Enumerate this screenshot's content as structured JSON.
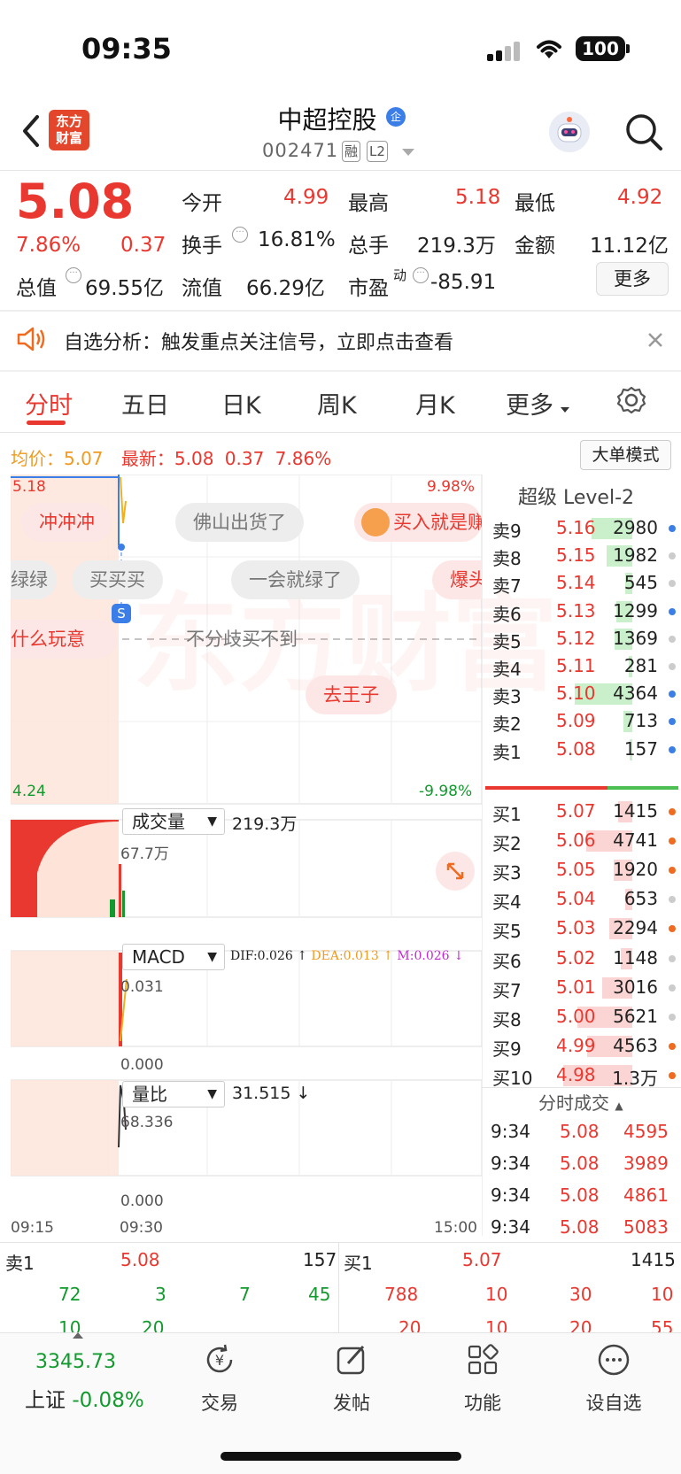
{
  "status": {
    "time": "09:35",
    "battery": "100"
  },
  "header": {
    "logo_line1": "东方",
    "logo_line2": "财富",
    "title": "中超控股",
    "title_badge": "企",
    "code": "002471",
    "tag_rong": "融",
    "tag_l2": "L2"
  },
  "quote": {
    "price": "5.08",
    "change_pct": "7.86%",
    "change": "0.37",
    "open_label": "今开",
    "open": "4.99",
    "high_label": "最高",
    "high": "5.18",
    "low_label": "最低",
    "low": "4.92",
    "turnover_label": "换手",
    "turnover": "16.81%",
    "volume_label": "总手",
    "volume": "219.3万",
    "amount_label": "金额",
    "amount": "11.12亿",
    "mcap_label": "总值",
    "mcap": "69.55亿",
    "float_label": "流值",
    "float": "66.29亿",
    "pe_label": "市盈",
    "pe_sup": "动",
    "pe": "-85.91",
    "more": "更多"
  },
  "notice": {
    "text": "自选分析：触发重点关注信号，立即点击查看"
  },
  "tabs": [
    "分时",
    "五日",
    "日K",
    "周K",
    "月K",
    "更多"
  ],
  "chart_info": {
    "avg_label": "均价：",
    "avg": "5.07",
    "last_label": "最新：",
    "last": "5.08",
    "change": "0.37",
    "pct": "7.86%",
    "mode_button": "大单模式"
  },
  "chart_data": {
    "type": "line",
    "title": "",
    "y_max": "5.18",
    "y_min": "4.24",
    "pct_max": "9.98%",
    "pct_min": "-9.98%",
    "x_ticks": [
      "09:15",
      "09:30",
      "15:00"
    ],
    "price": [
      5.08,
      5.18,
      5.13,
      5.08
    ],
    "volume_panel": {
      "label": "成交量",
      "total": "219.3万",
      "max": "67.7万"
    },
    "macd_panel": {
      "label": "MACD",
      "dif": "DIF:0.026",
      "dea": "DEA:0.013",
      "m": "M:0.026",
      "max": "0.031",
      "min": "0.000"
    },
    "ratio_panel": {
      "label": "量比",
      "value": "31.515",
      "max": "68.336",
      "min": "0.000"
    }
  },
  "danmaku": [
    {
      "text": "冲冲冲",
      "style": "r"
    },
    {
      "text": "佛山出货了",
      "style": "g"
    },
    {
      "text": "买入就是赚",
      "style": "r"
    },
    {
      "text": "绿绿",
      "style": "g"
    },
    {
      "text": "买买买",
      "style": "g"
    },
    {
      "text": "一会就绿了",
      "style": "g"
    },
    {
      "text": "爆头",
      "style": "r"
    },
    {
      "text": "什么玩意",
      "style": "r"
    },
    {
      "text": "不分歧买不到",
      "style": "g"
    },
    {
      "text": "去王子",
      "style": "r"
    }
  ],
  "watermark": "东方财富",
  "orderbook": {
    "title": "超级 Level-2",
    "sells": [
      {
        "label": "卖9",
        "price": "5.16",
        "vol": "2980",
        "fill": 0.35,
        "dot": "#3b7ee8"
      },
      {
        "label": "卖8",
        "price": "5.15",
        "vol": "1982",
        "fill": 0.22,
        "dot": "#ccc"
      },
      {
        "label": "卖7",
        "price": "5.14",
        "vol": "545",
        "fill": 0.06,
        "dot": "#ccc"
      },
      {
        "label": "卖6",
        "price": "5.13",
        "vol": "1299",
        "fill": 0.14,
        "dot": "#3b7ee8"
      },
      {
        "label": "卖5",
        "price": "5.12",
        "vol": "1369",
        "fill": 0.15,
        "dot": "#ccc"
      },
      {
        "label": "卖4",
        "price": "5.11",
        "vol": "281",
        "fill": 0.03,
        "dot": "#ccc"
      },
      {
        "label": "卖3",
        "price": "5.10",
        "vol": "4364",
        "fill": 0.5,
        "dot": "#3b7ee8"
      },
      {
        "label": "卖2",
        "price": "5.09",
        "vol": "713",
        "fill": 0.08,
        "dot": "#3b7ee8"
      },
      {
        "label": "卖1",
        "price": "5.08",
        "vol": "157",
        "fill": 0.02,
        "dot": "#3b7ee8"
      }
    ],
    "buys": [
      {
        "label": "买1",
        "price": "5.07",
        "vol": "1415",
        "fill": 0.12,
        "dot": "#f06a1f"
      },
      {
        "label": "买2",
        "price": "5.06",
        "vol": "4741",
        "fill": 0.4,
        "dot": "#f06a1f"
      },
      {
        "label": "买3",
        "price": "5.05",
        "vol": "1920",
        "fill": 0.16,
        "dot": "#f06a1f"
      },
      {
        "label": "买4",
        "price": "5.04",
        "vol": "653",
        "fill": 0.06,
        "dot": "#ccc"
      },
      {
        "label": "买5",
        "price": "5.03",
        "vol": "2294",
        "fill": 0.2,
        "dot": "#f06a1f"
      },
      {
        "label": "买6",
        "price": "5.02",
        "vol": "1148",
        "fill": 0.1,
        "dot": "#ccc"
      },
      {
        "label": "买7",
        "price": "5.01",
        "vol": "3016",
        "fill": 0.26,
        "dot": "#ccc"
      },
      {
        "label": "买8",
        "price": "5.00",
        "vol": "5621",
        "fill": 0.48,
        "dot": "#ccc"
      },
      {
        "label": "买9",
        "price": "4.99",
        "vol": "4563",
        "fill": 0.39,
        "dot": "#f06a1f"
      },
      {
        "label": "买10",
        "price": "4.98",
        "vol": "1.3万",
        "fill": 0.6,
        "dot": "#f06a1f"
      }
    ],
    "trades_title": "分时成交",
    "trades": [
      {
        "time": "9:34",
        "price": "5.08",
        "vol": "4595"
      },
      {
        "time": "9:34",
        "price": "5.08",
        "vol": "3989"
      },
      {
        "time": "9:34",
        "price": "5.08",
        "vol": "4861"
      },
      {
        "time": "9:34",
        "price": "5.08",
        "vol": "5083"
      }
    ]
  },
  "queue": {
    "sell_label": "卖1",
    "sell_price": "5.08",
    "sell_vol": "157",
    "buy_label": "买1",
    "buy_price": "5.07",
    "buy_vol": "1415",
    "sell_nums": [
      "72",
      "3",
      "7",
      "45"
    ],
    "sell_nums2": [
      "10",
      "20"
    ],
    "buy_nums": [
      "788",
      "10",
      "30",
      "10"
    ],
    "buy_nums2": [
      "20",
      "10",
      "20",
      "55"
    ]
  },
  "bottom": {
    "index_value": "3345.73",
    "index_label": "上证",
    "index_change": "-0.08%",
    "nav": [
      "交易",
      "发帖",
      "功能",
      "设自选"
    ]
  }
}
